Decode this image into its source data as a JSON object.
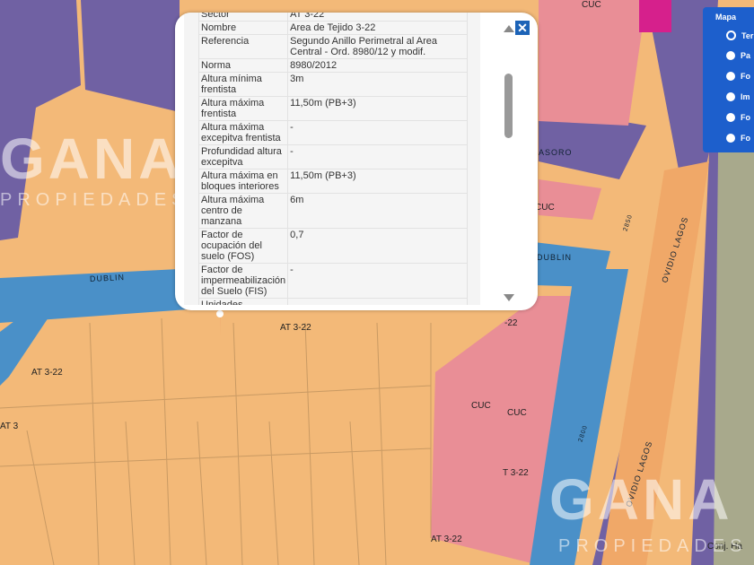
{
  "popup": {
    "rows": [
      {
        "key": "Sector",
        "value": "AT 3-22"
      },
      {
        "key": "Nombre",
        "value": "Area de Tejido 3-22"
      },
      {
        "key": "Referencia",
        "value": "Segundo Anillo Perimetral al Area Central - Ord. 8980/12 y modif."
      },
      {
        "key": "Norma",
        "value": "8980/2012"
      },
      {
        "key": "Altura mínima frentista",
        "value": "3m"
      },
      {
        "key": "Altura máxima frentista",
        "value": "11,50m (PB+3)"
      },
      {
        "key": "Altura máxima excepitva frentista",
        "value": "-"
      },
      {
        "key": "Profundidad altura excepitva",
        "value": "-"
      },
      {
        "key": "Altura máxima en bloques interiores",
        "value": "11,50m (PB+3)"
      },
      {
        "key": "Altura máxima centro de manzana",
        "value": "6m"
      },
      {
        "key": "Factor de ocupación del suelo (FOS)",
        "value": "0,7"
      },
      {
        "key": "Factor de impermeabilización del Suelo (FIS)",
        "value": "-"
      },
      {
        "key": "Unidades",
        "value": ""
      }
    ],
    "close_icon": "✕"
  },
  "layers": {
    "title": "Mapa",
    "options": [
      {
        "label": "Ter",
        "selected": true
      },
      {
        "label": "Pa",
        "selected": false
      },
      {
        "label": "Fo",
        "selected": false
      },
      {
        "label": "Im",
        "selected": false
      },
      {
        "label": "Fo",
        "selected": false
      },
      {
        "label": "Fo",
        "selected": false
      }
    ]
  },
  "map": {
    "streets": {
      "dublin": "DUBLIN",
      "dublin2": "DUBLIN",
      "ovidio1": "OVIDIO LAGOS",
      "ovidio2": "OVIDIO LAGOS",
      "asoro": "ASORO",
      "n2850": "2850",
      "n2800": "2800"
    },
    "labels": {
      "at322a": "AT 3-22",
      "at322b": "AT 3-22",
      "at322c": "T 3-22",
      "at322d": "AT 3-22",
      "at322e": "-22",
      "at3": "AT 3",
      "cuc1": "CUC",
      "cuc2": "CUC",
      "cuc3": "CUC",
      "cuc4": "CUC",
      "conj": "Conj. Ha"
    },
    "watermark": {
      "brand": "GANA",
      "sub": "PROPIEDADES"
    }
  },
  "colors": {
    "residential": "#f3b978",
    "commercial": "#e98e96",
    "zone": "#7061a3",
    "street": "#4a90c8",
    "avenue": "#f0a868",
    "layer_panel": "#1d5fcc"
  }
}
